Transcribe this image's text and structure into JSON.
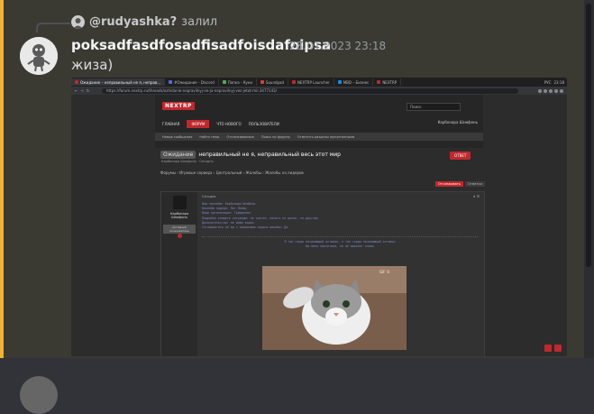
{
  "message": {
    "reply": {
      "author": "@rudyashka?",
      "text": "залил"
    },
    "author": "poksadfasdfosadfisadfoisdafoipsa",
    "timestamp": "28.01.2023 23:18",
    "content": "жиза)"
  },
  "attachment": {
    "browser": {
      "tabs": [
        {
          "label": "Ожидание – неправильный не я, неправ...",
          "color": "#c0282d"
        },
        {
          "label": "#Ожидание - Discord",
          "color": "#5865f2"
        },
        {
          "label": "Папка - Куки",
          "color": "#4caf50"
        },
        {
          "label": "Soundpad",
          "color": "#e53935"
        },
        {
          "label": "NEXTRP Launcher",
          "color": "#c0282d"
        },
        {
          "label": "MBD – Бизнес",
          "color": "#1e88e5"
        },
        {
          "label": "NEXTRP",
          "color": "#c0282d"
        }
      ],
      "clock": "23:18",
      "lang": "РУС",
      "url": "https://forum.nextrp.ru/threads/ozhidanie-nepravilnyj-ne-ja-nepravilnyj-ves-jetot-mir.3477143/"
    },
    "site": {
      "logo": "NEXTRP",
      "search_placeholder": "Поиск",
      "nav": [
        "ГЛАВНАЯ",
        "ФОРУМ",
        "ЧТО НОВОГО",
        "ПОЛЬЗОВАТЕЛИ"
      ],
      "nav_user": "Карбонара Шнифонь",
      "subnav": [
        "Новые сообщения",
        "Найти темы",
        "Отслеживаемые",
        "Поиск по форуму",
        "Отметить разделы прочитанными"
      ],
      "thread_prefix": "Ожидание",
      "thread_title": "неправильный не я, неправильный весь этот мир",
      "thread_meta": "Карбонара Шнифонь · Сегодня",
      "answer_label": "ОТВЕТ",
      "breadcrumbs": "Форумы › Игровые сервера › Центральный › Жалобы › Жалобы на лидеров",
      "pager": [
        "Отслеживать",
        "Отметки"
      ],
      "post": {
        "username": "Карбонара Шнифонь",
        "role": "Активный пользователь",
        "date": "Сегодня",
        "code_lines": [
          "Ваш никнейм: Карбонара Шнифонь",
          "Никнейм лидера: Яхт Пиявц",
          "Ваша организация: Гражданин",
          "Подробно опишите ситуацию: не трогал, ничего не делал, по-другому",
          "Доказательства: не имею видео",
          "Соглашаетесь ли вы с правилами подачи жалобы: Да"
        ],
        "note_lines": [
          "Я так гордо почивающий оставил, я так гордо почивающий оставил",
          "Вы меня прочитали, но не выкинет слова"
        ],
        "image_caption": "GIF ©"
      }
    }
  }
}
